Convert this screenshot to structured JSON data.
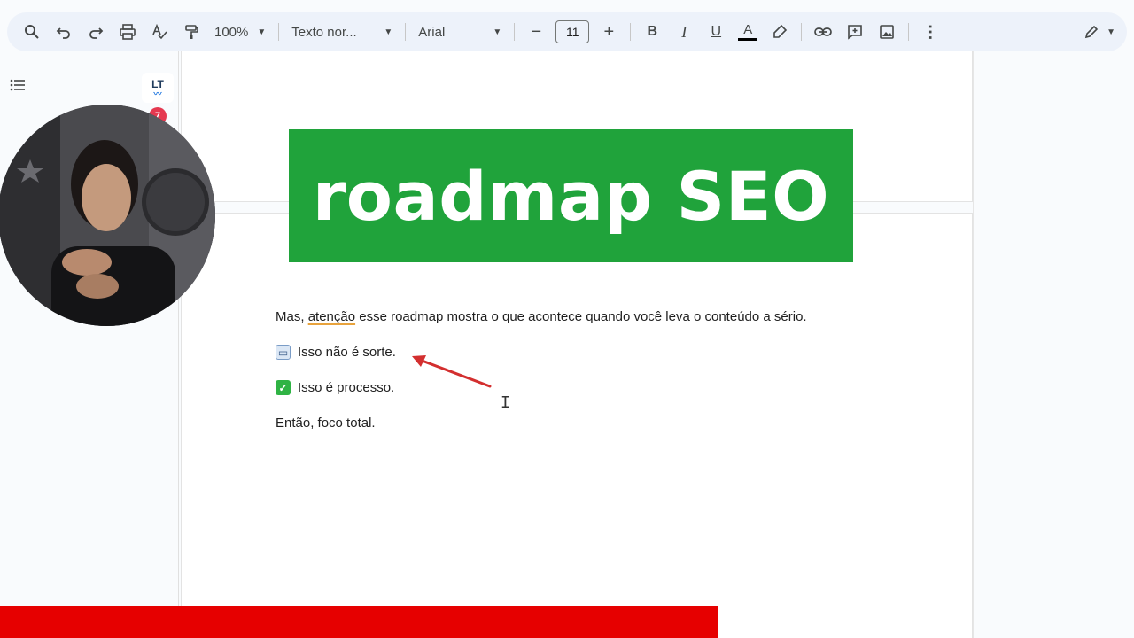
{
  "toolbar": {
    "search_icon": "search-icon",
    "undo_icon": "undo-icon",
    "redo_icon": "redo-icon",
    "print_icon": "print-icon",
    "spellcheck_icon": "spellcheck-icon",
    "paint_format_icon": "paint-format-icon",
    "zoom": "100%",
    "style": "Texto nor...",
    "font": "Arial",
    "font_size": "11",
    "bold": "B",
    "italic": "I",
    "underline": "U",
    "text_color": "A",
    "minus": "−",
    "plus": "+"
  },
  "sidebar": {
    "lt_label": "LT",
    "lt_count": "7"
  },
  "banner": {
    "text": "roadmap SEO",
    "color": "#20a33b"
  },
  "document": {
    "line1_before": "Mas, ",
    "line1_flagged": "atenção",
    "line1_after": " esse roadmap mostra o que acontece quando você leva o conteúdo a sério.",
    "line2": "Isso não é sorte.",
    "line3": "Isso é processo.",
    "line4": "Então, foco total."
  },
  "colors": {
    "accent_red": "#e60000",
    "arrow": "#d32f2f"
  }
}
